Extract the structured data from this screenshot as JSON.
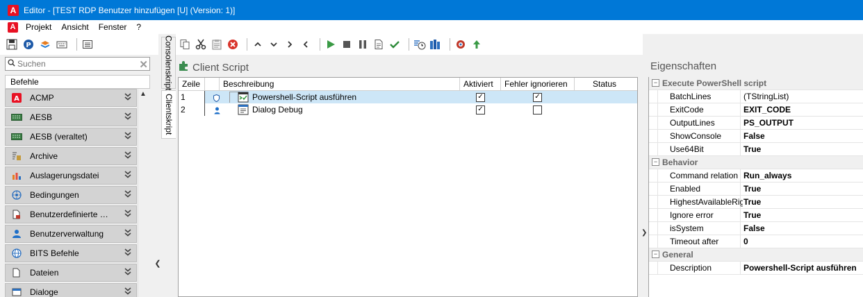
{
  "window": {
    "title": "Editor - [TEST RDP Benutzer hinzufügen [U] (Version: 1)]",
    "logo_letter": "A",
    "accent": "#0078d7"
  },
  "menu": [
    "Projekt",
    "Ansicht",
    "Fenster",
    "?"
  ],
  "search": {
    "placeholder": "Suchen",
    "value": ""
  },
  "commands": {
    "header": "Befehle",
    "items": [
      {
        "label": "ACMP",
        "icon": "acmp-icon"
      },
      {
        "label": "AESB",
        "icon": "aesb-icon"
      },
      {
        "label": "AESB (veraltet)",
        "icon": "aesb-legacy-icon"
      },
      {
        "label": "Archive",
        "icon": "archive-icon"
      },
      {
        "label": "Auslagerungsdatei",
        "icon": "chart-icon"
      },
      {
        "label": "Bedingungen",
        "icon": "conditions-icon"
      },
      {
        "label": "Benutzerdefinierte Skripte",
        "icon": "script-file-icon"
      },
      {
        "label": "Benutzerverwaltung",
        "icon": "user-icon"
      },
      {
        "label": "BITS Befehle",
        "icon": "globe-icon"
      },
      {
        "label": "Dateien",
        "icon": "file-icon"
      },
      {
        "label": "Dialoge",
        "icon": "dialog-icon"
      }
    ]
  },
  "tabs": [
    {
      "label": "Consolenskript",
      "active": false
    },
    {
      "label": "Clientskript",
      "active": true
    }
  ],
  "main": {
    "title": "Client Script",
    "columns": [
      "Zeile",
      "Beschreibung",
      "Aktiviert",
      "Fehler ignorieren",
      "Status"
    ],
    "rows": [
      {
        "line": "1",
        "description": "Powershell-Script ausführen",
        "enabled": true,
        "ignore_errors": true,
        "status": "",
        "selected": true
      },
      {
        "line": "2",
        "description": "Dialog Debug",
        "enabled": true,
        "ignore_errors": false,
        "status": "",
        "selected": false
      }
    ]
  },
  "properties": {
    "title": "Eigenschaften",
    "rows": [
      {
        "type": "category",
        "name": "Execute PowerShell script"
      },
      {
        "type": "prop",
        "name": "BatchLines",
        "value": "(TStringList)",
        "bold": false
      },
      {
        "type": "prop",
        "name": "ExitCode",
        "value": "EXIT_CODE",
        "bold": true
      },
      {
        "type": "prop",
        "name": "OutputLines",
        "value": "PS_OUTPUT",
        "bold": true
      },
      {
        "type": "prop",
        "name": "ShowConsole",
        "value": "False",
        "bold": true
      },
      {
        "type": "prop",
        "name": "Use64Bit",
        "value": "True",
        "bold": true
      },
      {
        "type": "category",
        "name": "Behavior"
      },
      {
        "type": "prop",
        "name": "Command relation",
        "value": "Run_always",
        "bold": true
      },
      {
        "type": "prop",
        "name": "Enabled",
        "value": "True",
        "bold": true
      },
      {
        "type": "prop",
        "name": "HighestAvailableRights",
        "value": "True",
        "bold": true
      },
      {
        "type": "prop",
        "name": "Ignore error",
        "value": "True",
        "bold": true
      },
      {
        "type": "prop",
        "name": "isSystem",
        "value": "False",
        "bold": true
      },
      {
        "type": "prop",
        "name": "Timeout after",
        "value": "0",
        "bold": true
      },
      {
        "type": "category",
        "name": "General"
      },
      {
        "type": "prop",
        "name": "Description",
        "value": "Powershell-Script ausführen",
        "bold": true
      }
    ]
  }
}
